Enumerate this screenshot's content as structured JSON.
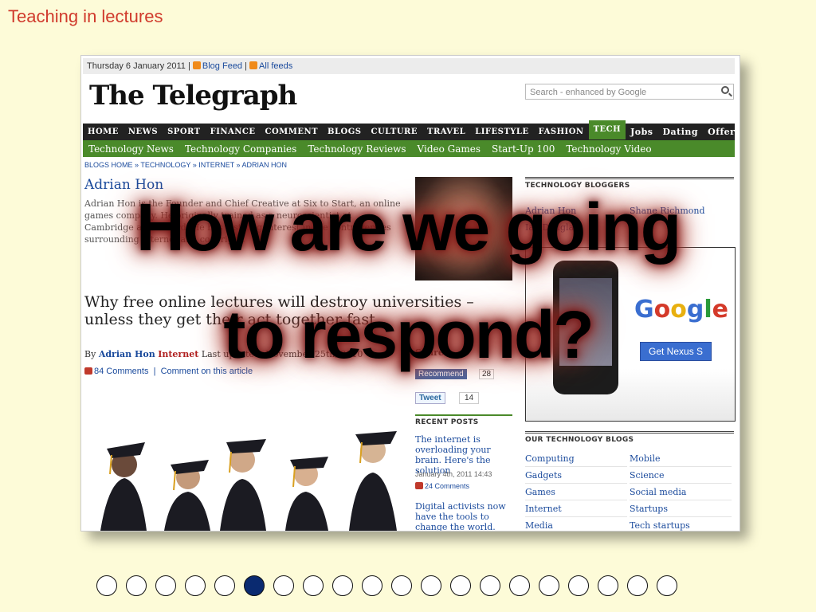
{
  "slide": {
    "title": "Teaching in lectures",
    "overlay_line1": "How are we going",
    "overlay_line2": "to respond?"
  },
  "browser": {
    "date_text": "Thursday 6 January 2011 |",
    "blog_feed": "Blog Feed",
    "all_feeds": "All feeds",
    "logo": "The Telegraph",
    "search_placeholder": "Search - enhanced by Google",
    "nav": [
      "HOME",
      "NEWS",
      "SPORT",
      "FINANCE",
      "COMMENT",
      "BLOGS",
      "CULTURE",
      "TRAVEL",
      "LIFESTYLE",
      "FASHION",
      "TECH"
    ],
    "nav_right": [
      "Jobs",
      "Dating",
      "Offers"
    ],
    "subnav": [
      "Technology News",
      "Technology Companies",
      "Technology Reviews",
      "Video Games",
      "Start-Up 100",
      "Technology Video"
    ],
    "breadcrumb": "BLOGS HOME » TECHNOLOGY » INTERNET » ADRIAN HON",
    "author": "Adrian Hon",
    "bio": "Adrian Hon is the Founder and Chief Creative at Six to Start, an online games company. He originally trained as a neuroscientist at Cambridge and Oxford. He has a strong interest in the controversies surrounding internet and copyright.",
    "headline": "Why free online lectures will destroy universities – unless they get their act together fast",
    "byline_by": "By",
    "byline_author": "Adrian Hon",
    "byline_category": "Internet",
    "byline_updated": "Last updated: November 25th, 2010",
    "comments_link": "84 Comments",
    "comment_on": "Comment on this article",
    "share_label": "Share",
    "recommend_label": "Recommend",
    "recommend_count": "28",
    "tweet_label": "Tweet",
    "tweet_count": "14",
    "recent_posts_header": "RECENT POSTS",
    "recent_posts": [
      {
        "title": "The internet is overloading your brain. Here's the solution",
        "date": "January 4th, 2011 14:43",
        "comments": "24 Comments"
      },
      {
        "title": "Digital activists now have the tools to change the world. Expect",
        "date": "",
        "comments": ""
      }
    ],
    "tech_bloggers_header": "TECHNOLOGY BLOGGERS",
    "bloggers": [
      "Adrian Hon",
      "Shane Richmond",
      "Ian Douglas"
    ],
    "ad_brand": "Google",
    "ad_button": "Get Nexus S",
    "tech_blogs_header": "OUR TECHNOLOGY BLOGS",
    "tech_blogs": [
      "Computing",
      "Mobile",
      "Gadgets",
      "Science",
      "Games",
      "Social media",
      "Internet",
      "Startups",
      "Media",
      "Tech startups"
    ]
  },
  "pagination": {
    "total": 20,
    "active_index": 5
  },
  "colors": {
    "background": "#fdfbd8",
    "title": "#d03a2c",
    "nav": "#222222",
    "tech_green": "#4a8a2a",
    "dot_active": "#0a2a70"
  }
}
